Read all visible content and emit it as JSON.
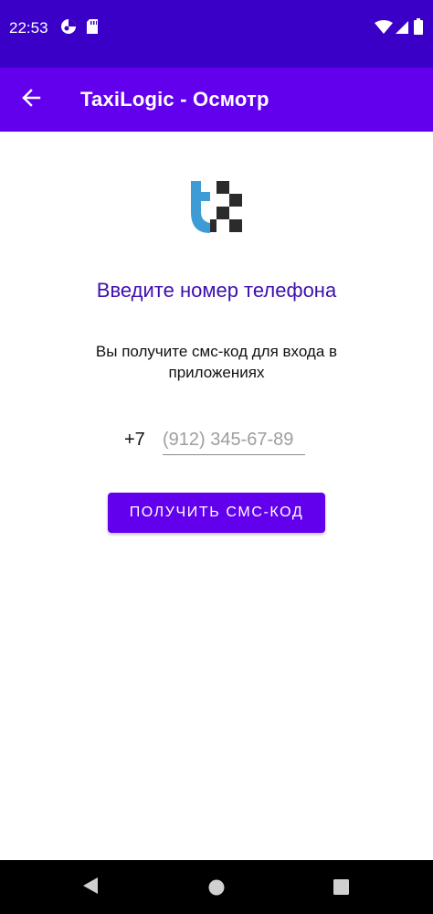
{
  "status_bar": {
    "time": "22:53",
    "icons": [
      "app-notification-icon",
      "sd-card-icon",
      "wifi-icon",
      "cellular-signal-icon",
      "battery-icon"
    ]
  },
  "app_bar": {
    "title": "TaxiLogic - Осмотр",
    "back_icon": "arrow-left-icon"
  },
  "logo": {
    "colors": {
      "blue": "#3d9bd6",
      "dark": "#2b2b2b"
    }
  },
  "main": {
    "heading": "Введите номер телефона",
    "subtext": "Вы получите смс-код для входа в приложениях",
    "phone": {
      "country_code": "+7",
      "value": "",
      "placeholder": "(912) 345-67-89"
    },
    "button_label": "ПОЛУЧИТЬ СМС-КОД"
  },
  "nav_bar": {
    "icons": [
      "back-triangle-icon",
      "home-circle-icon",
      "recents-square-icon"
    ]
  },
  "colors": {
    "status_bar": "#3a00c8",
    "primary": "#6200ee",
    "heading": "#3d0fb0"
  }
}
